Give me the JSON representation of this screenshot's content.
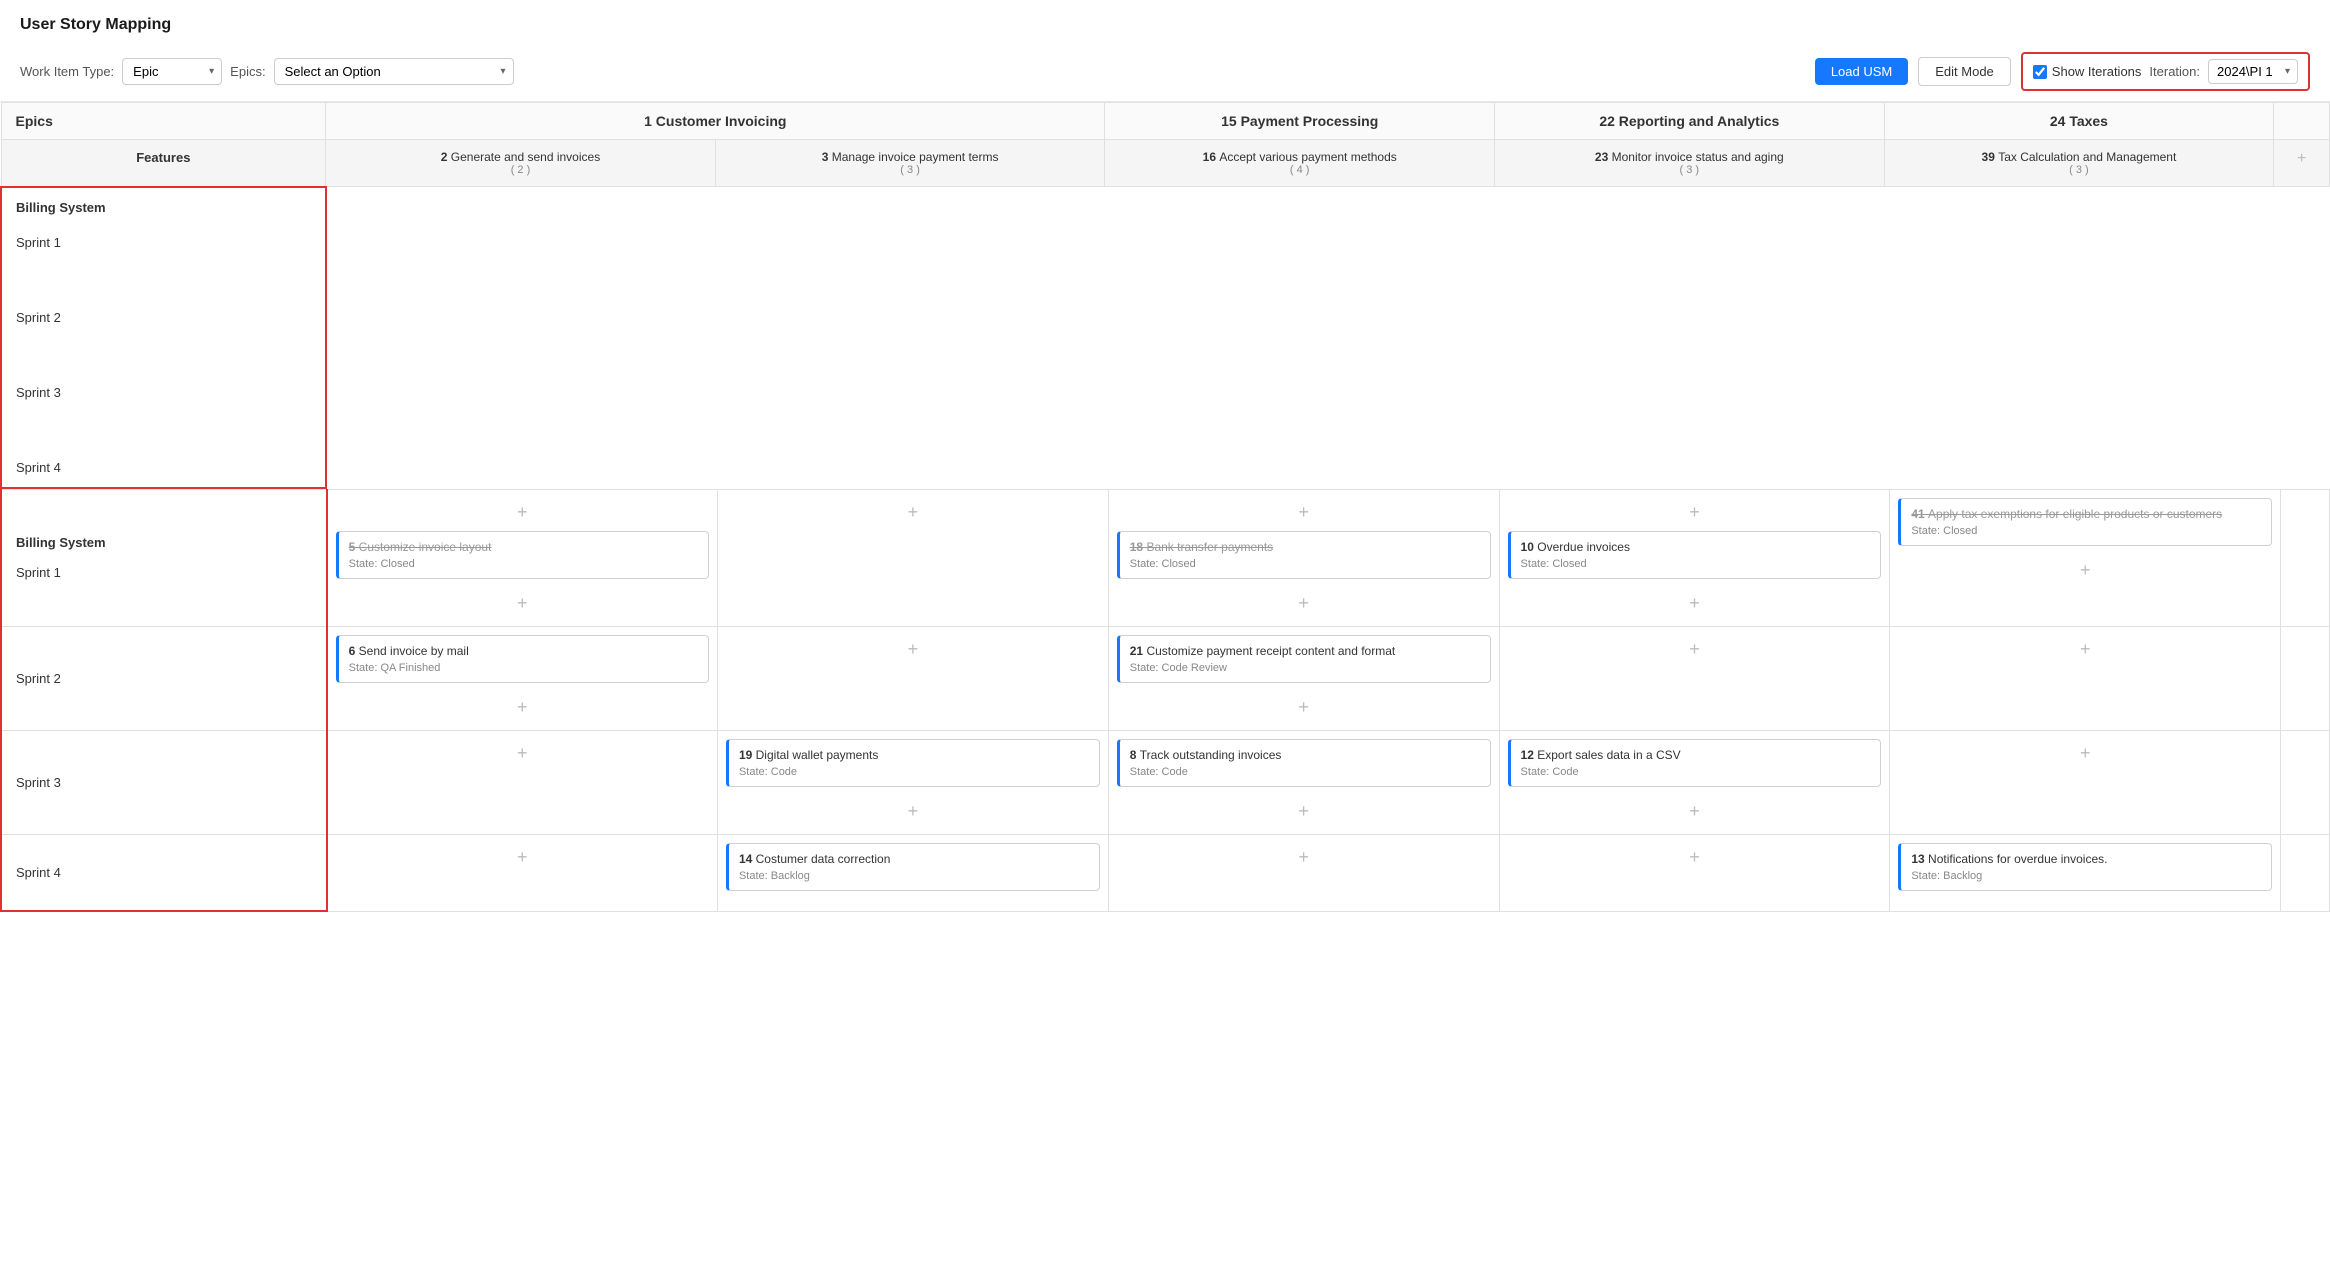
{
  "page": {
    "title": "User Story Mapping"
  },
  "toolbar": {
    "work_item_type_label": "Work Item Type:",
    "work_item_type_value": "Epic",
    "epics_label": "Epics:",
    "epics_placeholder": "Select an Option",
    "load_btn": "Load USM",
    "edit_btn": "Edit Mode",
    "show_iterations_label": "Show Iterations",
    "iteration_label": "Iteration:",
    "iteration_value": "2024\\PI 1"
  },
  "grid": {
    "epics_col_label": "Epics",
    "features_col_label": "Features",
    "epics": [
      {
        "id": "1",
        "name": "Customer Invoicing",
        "cols": 2
      },
      {
        "id": "15",
        "name": "Payment Processing",
        "cols": 1
      },
      {
        "id": "22",
        "name": "Reporting and Analytics",
        "cols": 1
      },
      {
        "id": "24",
        "name": "Taxes",
        "cols": 1
      }
    ],
    "features": [
      {
        "id": "2",
        "name": "Generate and send invoices",
        "count": "2"
      },
      {
        "id": "3",
        "name": "Manage invoice payment terms",
        "count": "3"
      },
      {
        "id": "16",
        "name": "Accept various payment methods",
        "count": "4"
      },
      {
        "id": "23",
        "name": "Monitor invoice status and aging",
        "count": "3"
      },
      {
        "id": "39",
        "name": "Tax Calculation and Management",
        "count": "3"
      }
    ],
    "billing_system_label": "Billing System",
    "sprints": [
      {
        "label": "Sprint 1"
      },
      {
        "label": "Sprint 2"
      },
      {
        "label": "Sprint 3"
      },
      {
        "label": "Sprint 4"
      }
    ],
    "stories": {
      "sprint1": {
        "f2": [
          {
            "id": "5",
            "title": "Customize invoice layout",
            "state": "Closed",
            "strikethrough": true
          }
        ],
        "f3": [],
        "f16": [
          {
            "id": "18",
            "title": "Bank transfer payments",
            "state": "Closed",
            "strikethrough": true
          }
        ],
        "f23": [
          {
            "id": "10",
            "title": "Overdue invoices",
            "state": "Closed",
            "strikethrough": false
          }
        ],
        "f39": [
          {
            "id": "41",
            "title": "Apply tax exemptions for eligible products or customers",
            "state": "Closed",
            "strikethrough": true
          }
        ]
      },
      "sprint2": {
        "f2": [
          {
            "id": "6",
            "title": "Send invoice by mail",
            "state": "QA Finished",
            "strikethrough": false
          }
        ],
        "f3": [],
        "f16": [
          {
            "id": "21",
            "title": "Customize payment receipt content and format",
            "state": "Code Review",
            "strikethrough": false
          }
        ],
        "f23": [],
        "f39": []
      },
      "sprint3": {
        "f2": [],
        "f3": [
          {
            "id": "19",
            "title": "Digital wallet payments",
            "state": "Code",
            "strikethrough": false
          }
        ],
        "f16": [
          {
            "id": "8",
            "title": "Track outstanding invoices",
            "state": "Code",
            "strikethrough": false
          }
        ],
        "f23": [
          {
            "id": "12",
            "title": "Export sales data in a CSV",
            "state": "Code",
            "strikethrough": false
          }
        ],
        "f39": []
      },
      "sprint4": {
        "f2": [],
        "f3": [
          {
            "id": "14",
            "title": "Costumer data correction",
            "state": "Backlog",
            "strikethrough": false
          }
        ],
        "f16": [],
        "f23": [],
        "f39": [
          {
            "id": "13",
            "title": "Notifications for overdue invoices.",
            "state": "Backlog",
            "strikethrough": false
          }
        ]
      }
    }
  }
}
